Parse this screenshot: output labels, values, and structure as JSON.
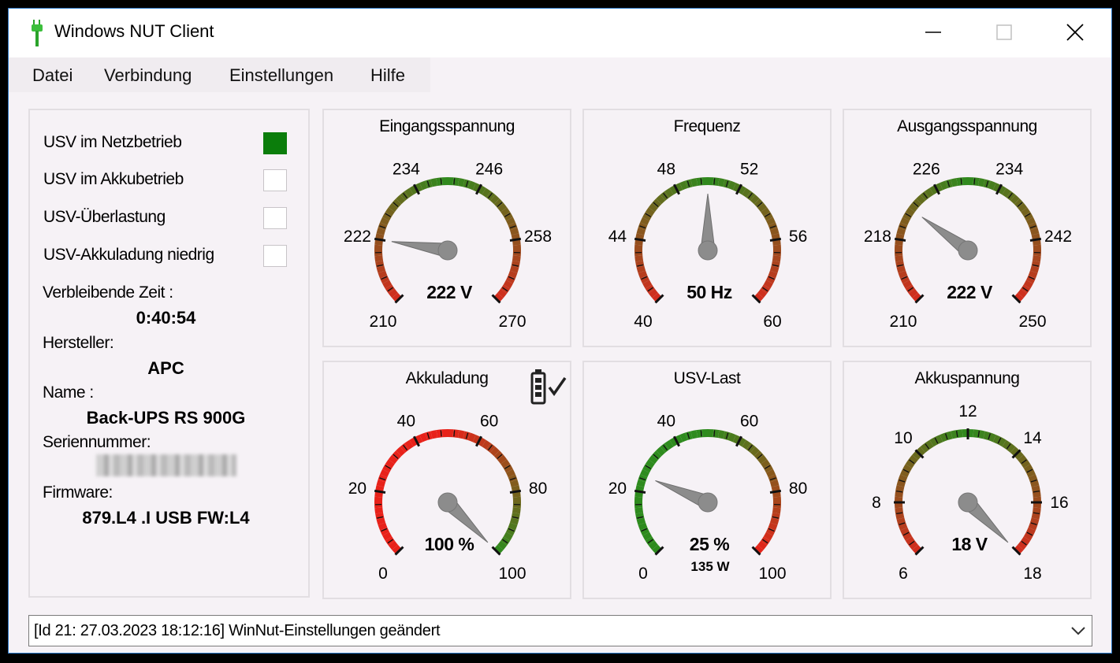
{
  "window": {
    "title": "Windows NUT Client",
    "icon": "plug-icon"
  },
  "menu": [
    {
      "label": "Datei"
    },
    {
      "label": "Verbindung"
    },
    {
      "label": "Einstellungen"
    },
    {
      "label": "Hilfe"
    }
  ],
  "indicators": [
    {
      "label": "USV im Netzbetrieb",
      "active": true
    },
    {
      "label": "USV im Akkubetrieb",
      "active": false
    },
    {
      "label": "USV-Überlastung",
      "active": false
    },
    {
      "label": "USV-Akkuladung niedrig",
      "active": false
    }
  ],
  "info": {
    "remaining_label": "Verbleibende Zeit :",
    "remaining_value": "0:40:54",
    "manufacturer_label": "Hersteller:",
    "manufacturer_value": "APC",
    "name_label": "Name :",
    "name_value": "Back-UPS RS 900G",
    "serial_label": "Seriennummer:",
    "firmware_label": "Firmware:",
    "firmware_value": "879.L4 .I USB FW:L4"
  },
  "gauges": [
    {
      "title": "Eingangsspannung",
      "min": 210,
      "max": 270,
      "value": 222,
      "readout": "222 V",
      "subreadout": "",
      "labels": [
        "210",
        "222",
        "234",
        "246",
        "258",
        "270"
      ],
      "gradient": [
        "#d52b1e",
        "#2e8b1e",
        "#d52b1e"
      ]
    },
    {
      "title": "Frequenz",
      "min": 40,
      "max": 60,
      "value": 50,
      "readout": "50 Hz",
      "subreadout": "",
      "labels": [
        "40",
        "44",
        "48",
        "52",
        "56",
        "60"
      ],
      "gradient": [
        "#d52b1e",
        "#2e8b1e",
        "#d52b1e"
      ]
    },
    {
      "title": "Ausgangsspannung",
      "min": 210,
      "max": 250,
      "value": 222,
      "readout": "222 V",
      "subreadout": "",
      "labels": [
        "210",
        "218",
        "226",
        "234",
        "242",
        "250"
      ],
      "gradient": [
        "#d52b1e",
        "#2e8b1e",
        "#d52b1e"
      ]
    },
    {
      "title": "Akkuladung",
      "min": 0,
      "max": 100,
      "value": 100,
      "readout": "100 %",
      "subreadout": "",
      "labels": [
        "0",
        "20",
        "40",
        "60",
        "80",
        "100"
      ],
      "gradient": [
        "#e8221a",
        "#e8221a",
        "#2e8b1e"
      ],
      "badge_icon": "battery-charged-icon"
    },
    {
      "title": "USV-Last",
      "min": 0,
      "max": 100,
      "value": 25,
      "readout": "25 %",
      "subreadout": "135 W",
      "labels": [
        "0",
        "20",
        "40",
        "60",
        "80",
        "100"
      ],
      "gradient": [
        "#2e8b1e",
        "#2e8b1e",
        "#e8221a"
      ]
    },
    {
      "title": "Akkuspannung",
      "min": 6,
      "max": 18,
      "value": 18,
      "readout": "18 V",
      "subreadout": "",
      "labels": [
        "6",
        "8",
        "10",
        "12",
        "14",
        "16",
        "18"
      ],
      "gradient": [
        "#d52b1e",
        "#2e8b1e",
        "#d52b1e"
      ]
    }
  ],
  "status": {
    "text": "[Id 21: 27.03.2023 18:12:16] WinNut-Einstellungen geändert"
  }
}
